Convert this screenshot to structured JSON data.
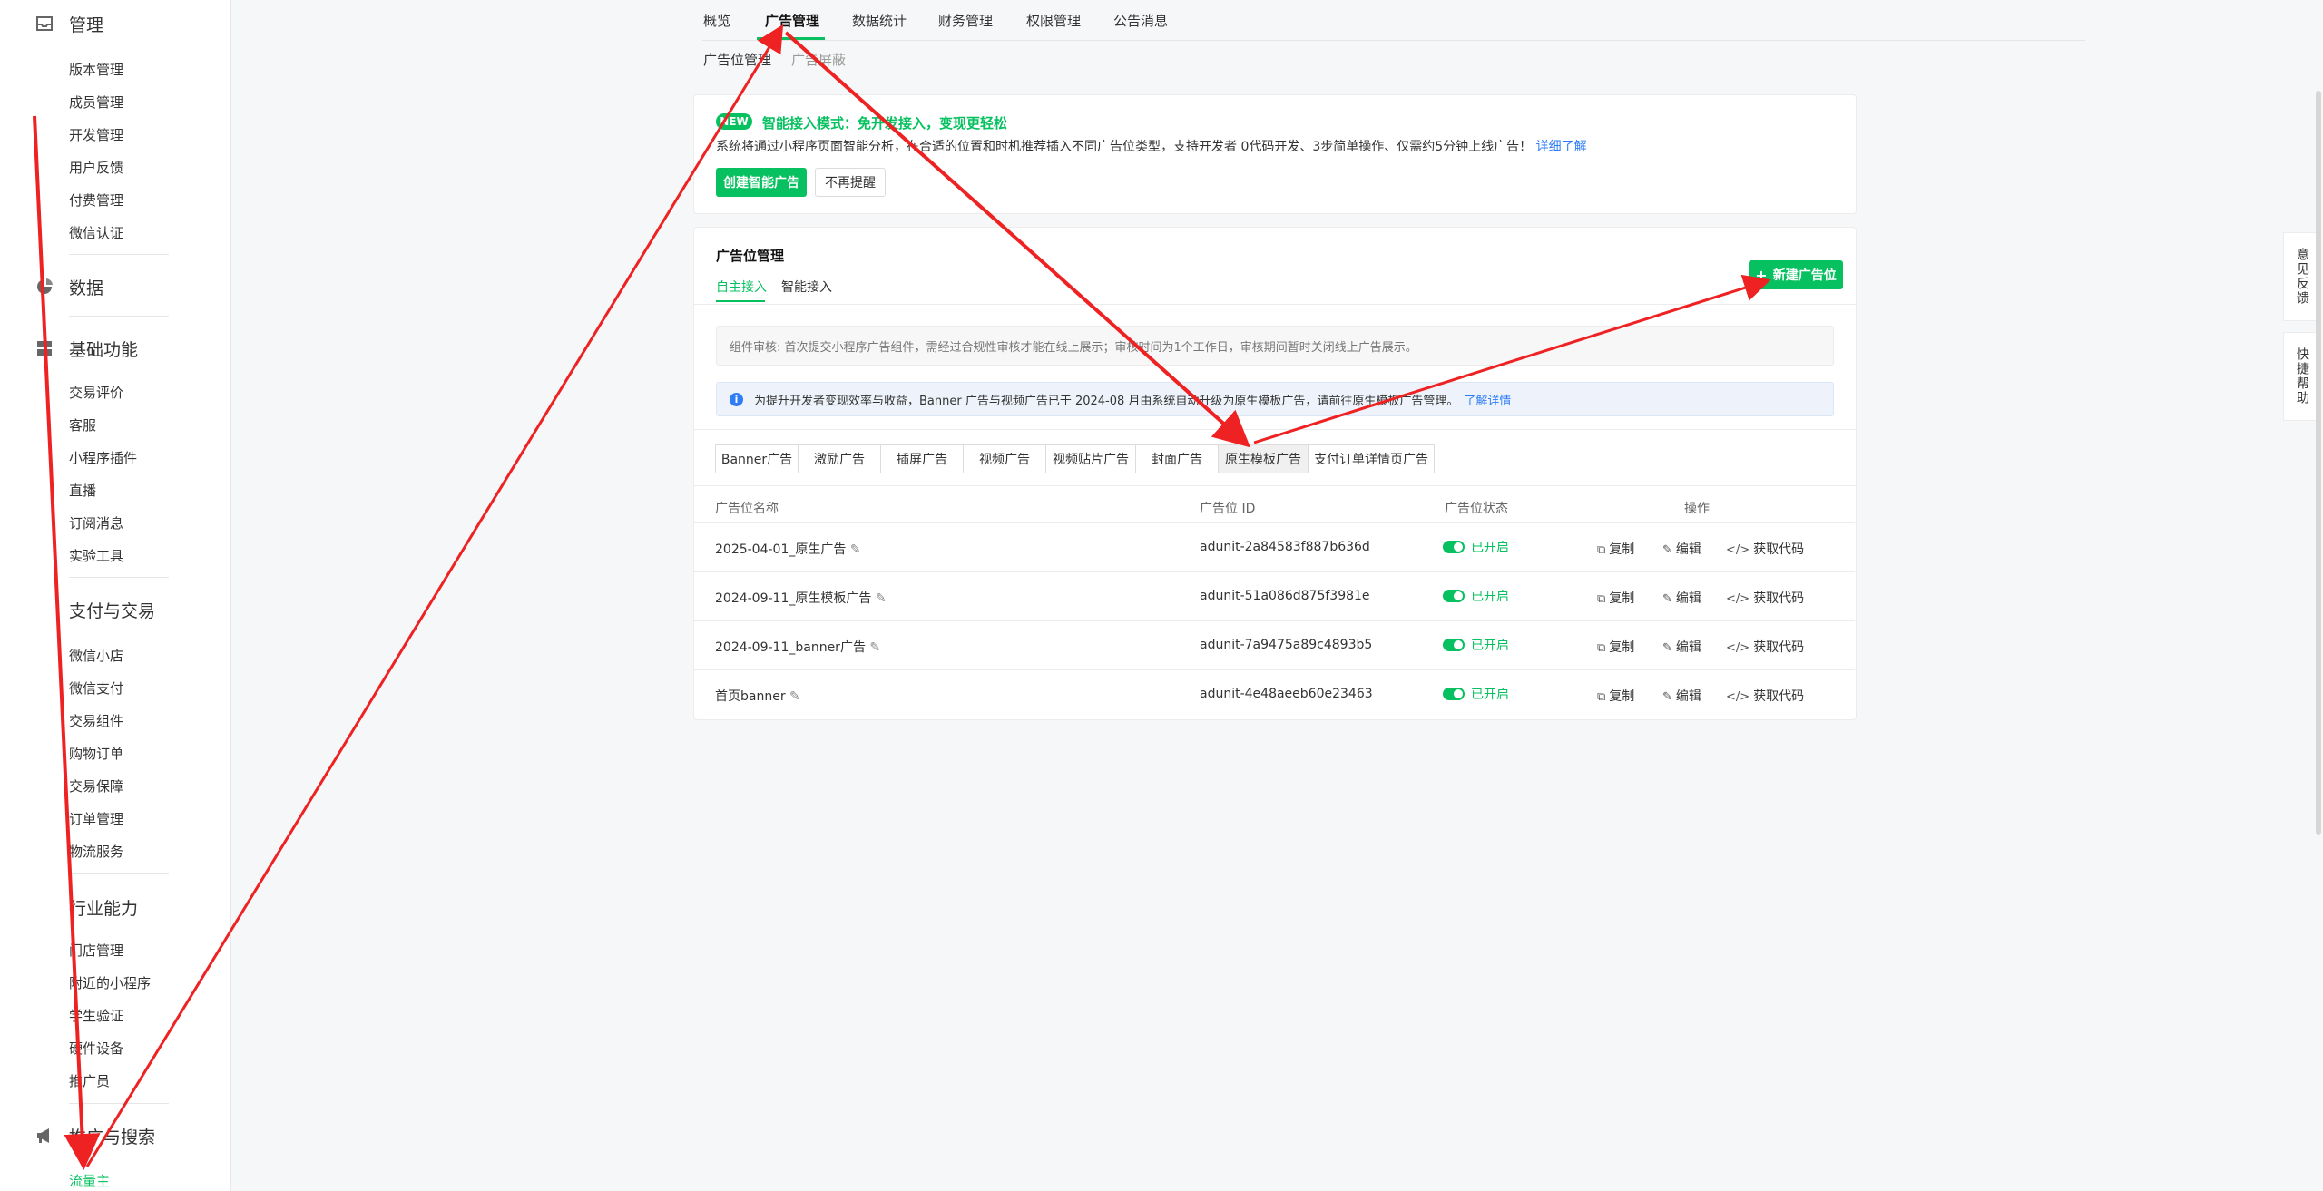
{
  "sidebar": {
    "sections": [
      {
        "title": "管理",
        "icon": "inbox-icon",
        "items": [
          "版本管理",
          "成员管理",
          "开发管理",
          "用户反馈",
          "付费管理",
          "微信认证"
        ]
      },
      {
        "title": "数据",
        "icon": "pie-chart-icon",
        "items": []
      },
      {
        "title": "基础功能",
        "icon": "grid-icon",
        "items": [
          "交易评价",
          "客服",
          "小程序插件",
          "直播",
          "订阅消息",
          "实验工具"
        ]
      },
      {
        "title": "支付与交易",
        "icon": "",
        "items": [
          "微信小店",
          "微信支付",
          "交易组件",
          "购物订单",
          "交易保障",
          "订单管理",
          "物流服务"
        ]
      },
      {
        "title": "行业能力",
        "icon": "",
        "items": [
          "门店管理",
          "附近的小程序",
          "学生验证",
          "硬件设备",
          "推广员"
        ]
      },
      {
        "title": "推广与搜索",
        "icon": "megaphone-icon",
        "items": [
          "流量主"
        ]
      }
    ],
    "active_item": "流量主"
  },
  "topnav": {
    "tabs": [
      "概览",
      "广告管理",
      "数据统计",
      "财务管理",
      "权限管理",
      "公告消息"
    ],
    "active": "广告管理"
  },
  "subnav": {
    "tabs": [
      "广告位管理",
      "广告屏蔽"
    ],
    "active": "广告位管理"
  },
  "promo": {
    "badge": "NEW",
    "title": "智能接入模式：免开发接入，变现更轻松",
    "desc": "系统将通过小程序页面智能分析，在合适的位置和时机推荐插入不同广告位类型，支持开发者 0代码开发、3步简单操作、仅需约5分钟上线广告！",
    "link": "详细了解",
    "btn_create": "创建智能广告",
    "btn_dismiss": "不再提醒"
  },
  "adunit": {
    "title": "广告位管理",
    "tabs": [
      "自主接入",
      "智能接入"
    ],
    "active_tab": "自主接入",
    "new_btn": "新建广告位",
    "notice1": "组件审核: 首次提交小程序广告组件，需经过合规性审核才能在线上展示；审核时间为1个工作日，审核期间暂时关闭线上广告展示。",
    "notice2": "为提升开发者变现效率与收益，Banner 广告与视频广告已于 2024-08 月由系统自动升级为原生模板广告，请前往原生模板广告管理。",
    "notice2_link": "了解详情",
    "types": [
      "Banner广告",
      "激励广告",
      "插屏广告",
      "视频广告",
      "视频贴片广告",
      "封面广告",
      "原生模板广告",
      "支付订单详情页广告"
    ],
    "active_type": "原生模板广告",
    "columns": [
      "广告位名称",
      "广告位 ID",
      "广告位状态",
      "操作"
    ],
    "rows": [
      {
        "name": "2025-04-01_原生广告",
        "id": "adunit-2a84583f887b636d",
        "status": "已开启"
      },
      {
        "name": "2024-09-11_原生模板广告",
        "id": "adunit-51a086d875f3981e",
        "status": "已开启"
      },
      {
        "name": "2024-09-11_banner广告",
        "id": "adunit-7a9475a89c4893b5",
        "status": "已开启"
      },
      {
        "name": "首页banner",
        "id": "adunit-4e48aeeb60e23463",
        "status": "已开启"
      }
    ],
    "actions": {
      "copy": "复制",
      "edit": "编辑",
      "code": "获取代码"
    }
  },
  "float": {
    "feedback": "意见反馈",
    "help": "快捷帮助"
  },
  "colors": {
    "accent": "#07c160",
    "annotation": "#ee2222",
    "link": "#2e7cf6"
  }
}
